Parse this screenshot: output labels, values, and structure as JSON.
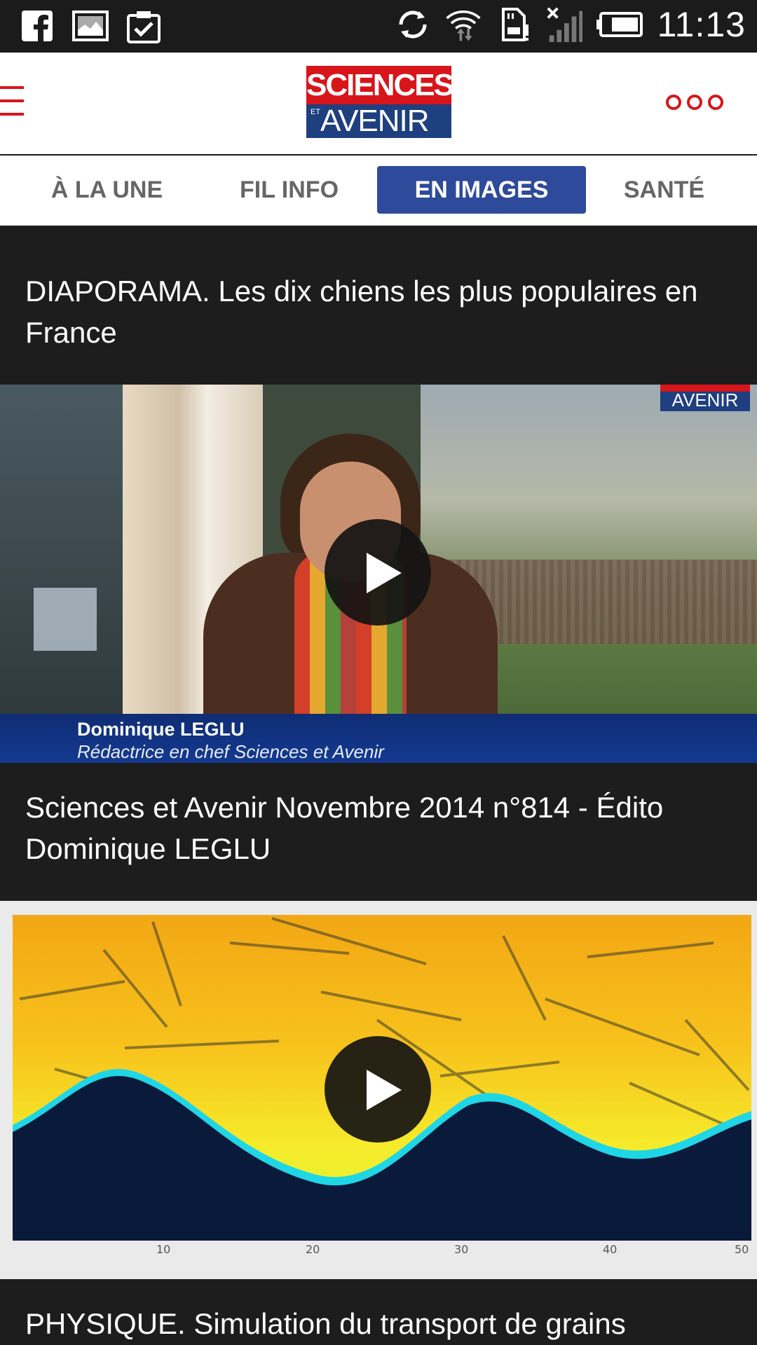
{
  "status_bar": {
    "time": "11:13",
    "left_icons": [
      "facebook-icon",
      "gallery-icon",
      "clipboard-check-icon"
    ],
    "right_icons": [
      "sync-icon",
      "wifi-icon",
      "sd-card-alert-icon",
      "signal-off-icon",
      "battery-icon"
    ]
  },
  "header": {
    "logo_top": "SCIENCES",
    "logo_et": "ET",
    "logo_bottom": "AVENIR",
    "brand_red": "#d7151a",
    "brand_blue": "#1e3f80"
  },
  "tabs": [
    {
      "label": "À LA UNE",
      "active": false
    },
    {
      "label": "FIL INFO",
      "active": false
    },
    {
      "label": "EN IMAGES",
      "active": true
    },
    {
      "label": "SANTÉ",
      "active": false
    }
  ],
  "feed": {
    "items": [
      {
        "title": "DIAPORAMA. Les dix chiens les plus populaires en France"
      },
      {
        "title": "Sciences et Avenir Novembre 2014 n°814 - Édito Dominique LEGLU",
        "video": true,
        "overlay_name": "Dominique LEGLU",
        "overlay_role": "Rédactrice en chef Sciences et Avenir",
        "watermark": "AVENIR"
      },
      {
        "title": "PHYSIQUE. Simulation du transport de grains",
        "video": true,
        "axis_ticks": [
          "10",
          "20",
          "30",
          "40",
          "50"
        ]
      }
    ]
  }
}
